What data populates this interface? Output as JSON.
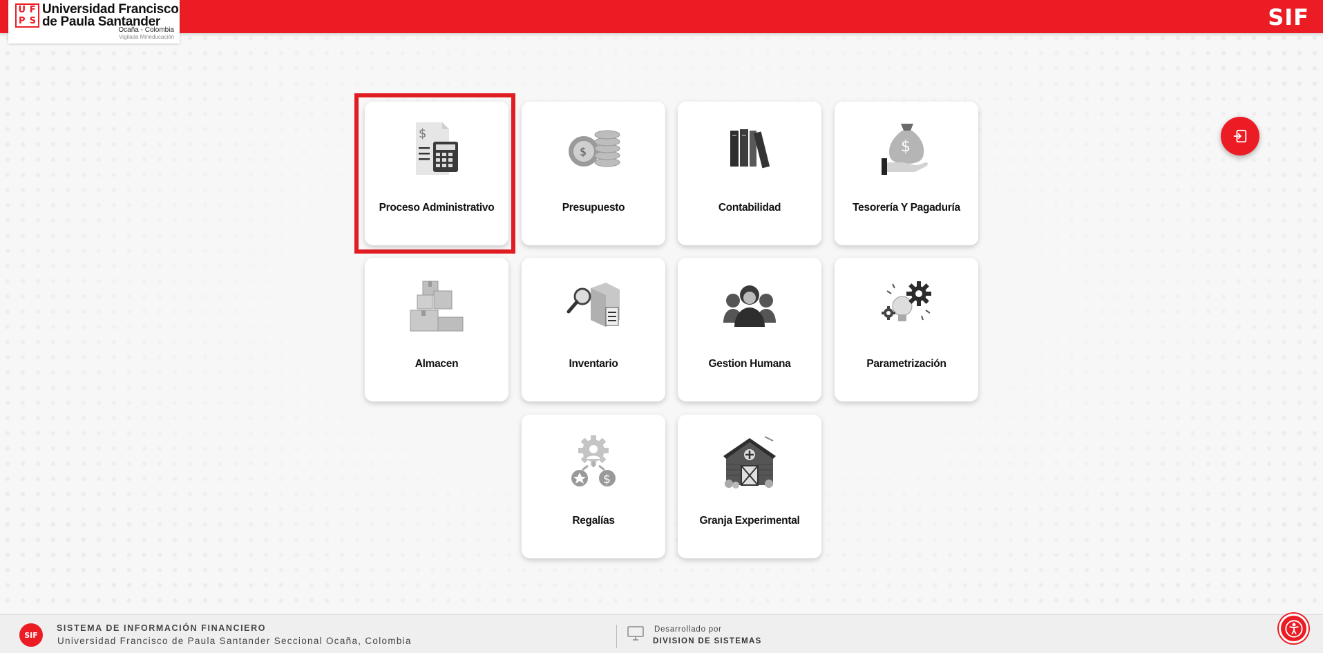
{
  "header": {
    "logo_letters": [
      "U",
      "F",
      "P",
      "S"
    ],
    "logo_name_line1": "Universidad Francisco",
    "logo_name_line2": "de Paula Santander",
    "logo_location": "Ocaña - Colombia",
    "logo_vigilada": "Vigilada Mineducación",
    "app_brand": "SIF"
  },
  "modules": [
    {
      "label": "Proceso Administrativo",
      "icon": "calculator-document-icon",
      "selected": true
    },
    {
      "label": "Presupuesto",
      "icon": "coins-icon",
      "selected": false
    },
    {
      "label": "Contabilidad",
      "icon": "books-icon",
      "selected": false
    },
    {
      "label": "Tesorería Y Pagaduría",
      "icon": "money-bag-hand-icon",
      "selected": false
    },
    {
      "label": "Almacen",
      "icon": "boxes-icon",
      "selected": false
    },
    {
      "label": "Inventario",
      "icon": "inventory-search-icon",
      "selected": false
    },
    {
      "label": "Gestion Humana",
      "icon": "people-group-icon",
      "selected": false
    },
    {
      "label": "Parametrización",
      "icon": "gears-bulb-icon",
      "selected": false
    },
    {
      "label": "Regalías",
      "icon": "gear-coin-icon",
      "selected": false
    },
    {
      "label": "Granja Experimental",
      "icon": "barn-icon",
      "selected": false
    }
  ],
  "exit_button": {
    "icon": "logout-icon"
  },
  "footer": {
    "logo_text": "SIF",
    "title": "SISTEMA DE INFORMACIÓN FINANCIERO",
    "subtitle": "Universidad Francisco de Paula Santander Seccional Ocaña, Colombia",
    "developed_by": "Desarrollado por",
    "developer": "DIVISION DE SISTEMAS",
    "monitor_icon": "monitor-icon",
    "accessibility_icon": "accessibility-icon"
  },
  "colors": {
    "brand_red": "#ec1c24",
    "selection_red": "#e11d24",
    "background": "#f7f7f7",
    "card": "#ffffff"
  }
}
